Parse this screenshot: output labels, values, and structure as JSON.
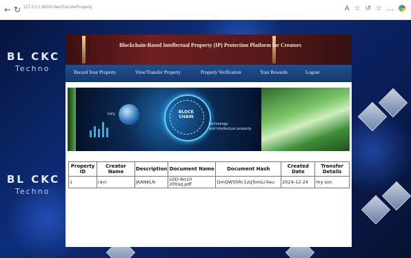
{
  "browser": {
    "url": "127.0.0.1:8000/ViewTransferProperty"
  },
  "brand": {
    "name": "BL CKC",
    "sub": "Techno"
  },
  "banner": {
    "title": "Blockchain-Based Intellectual Property (IP) Protection Platform for Creators"
  },
  "menu": {
    "items": [
      "Record Your Property",
      "View/Transfer Property",
      "Property Verification",
      "Your Rewards",
      "Logout"
    ]
  },
  "hero": {
    "center_label": "BLOCK CHAIN",
    "caption_line1": "technology",
    "caption_line2": "and intellectual property",
    "percent": "54%"
  },
  "table": {
    "headers": [
      "Property ID",
      "Creator Name",
      "Description",
      "Document Name",
      "Document Hash",
      "Created Date",
      "Transfer Details"
    ],
    "rows": [
      [
        "1",
        "ravi",
        "JKANKLN",
        "LOD-No10 200sq.pdf",
        "QmQW5hRc1zqTomLc4au",
        "2024-12-24",
        "my son"
      ]
    ]
  }
}
